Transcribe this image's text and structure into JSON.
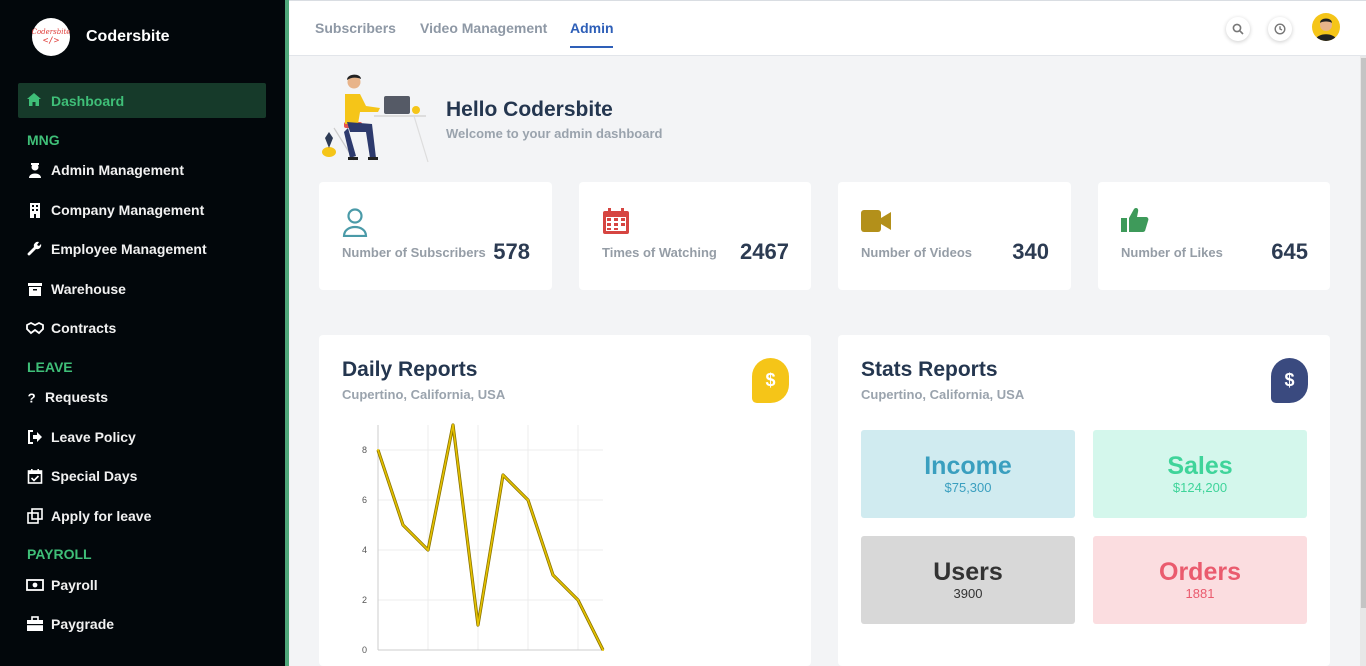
{
  "app": {
    "brand_name": "Codersbite",
    "logo_text": "Codersbite",
    "logo_code": "</>"
  },
  "sidebar": {
    "dashboard_label": "Dashboard",
    "sections": {
      "mng": "MNG",
      "leave": "LEAVE",
      "payroll": "PAYROLL"
    },
    "items": [
      {
        "label": "Admin Management",
        "icon": "user-secret-icon"
      },
      {
        "label": "Company Management",
        "icon": "building-icon"
      },
      {
        "label": "Employee Management",
        "icon": "wrench-icon"
      },
      {
        "label": "Warehouse",
        "icon": "archive-icon"
      },
      {
        "label": "Contracts",
        "icon": "handshake-icon"
      },
      {
        "label": "Requests",
        "icon": "question-icon"
      },
      {
        "label": "Leave Policy",
        "icon": "sign-out-icon"
      },
      {
        "label": "Special Days",
        "icon": "calendar-check-icon"
      },
      {
        "label": "Apply for leave",
        "icon": "copy-icon"
      },
      {
        "label": "Payroll",
        "icon": "money-bill-icon"
      },
      {
        "label": "Paygrade",
        "icon": "briefcase-icon"
      }
    ]
  },
  "topbar": {
    "tabs": [
      "Subscribers",
      "Video Management",
      "Admin"
    ],
    "active_tab": "Admin"
  },
  "hello": {
    "title": "Hello Codersbite",
    "subtitle": "Welcome to your admin dashboard"
  },
  "stats": [
    {
      "label": "Number of Subscribers",
      "value": "578",
      "icon": "user-icon",
      "color": "#4a9aa8"
    },
    {
      "label": "Times of Watching",
      "value": "2467",
      "icon": "calendar-icon",
      "color": "#d64541"
    },
    {
      "label": "Number of Videos",
      "value": "340",
      "icon": "video-icon",
      "color": "#b3901a"
    },
    {
      "label": "Number of Likes",
      "value": "645",
      "icon": "thumbs-up-icon",
      "color": "#3e9a5a"
    }
  ],
  "daily": {
    "title": "Daily Reports",
    "subtitle": "Cupertino, California, USA",
    "badge": "$",
    "badge_color": "#f5c518"
  },
  "statsReports": {
    "title": "Stats Reports",
    "subtitle": "Cupertino, California, USA",
    "badge": "$",
    "badge_color": "#3a4a7f",
    "tiles": [
      {
        "label": "Income",
        "value": "$75,300"
      },
      {
        "label": "Sales",
        "value": "$124,200"
      },
      {
        "label": "Users",
        "value": "3900"
      },
      {
        "label": "Orders",
        "value": "1881"
      }
    ]
  },
  "chart_data": {
    "type": "line",
    "y_ticks": [
      "8",
      "6",
      "4",
      "2",
      "0"
    ],
    "ylim": [
      0,
      9
    ],
    "x": [
      0,
      1,
      2,
      3,
      4,
      5,
      6,
      7,
      8,
      9
    ],
    "values": [
      8,
      5,
      4,
      9,
      1,
      7,
      6,
      3,
      2,
      0
    ],
    "line_color": "#e6c200",
    "grid": true
  }
}
